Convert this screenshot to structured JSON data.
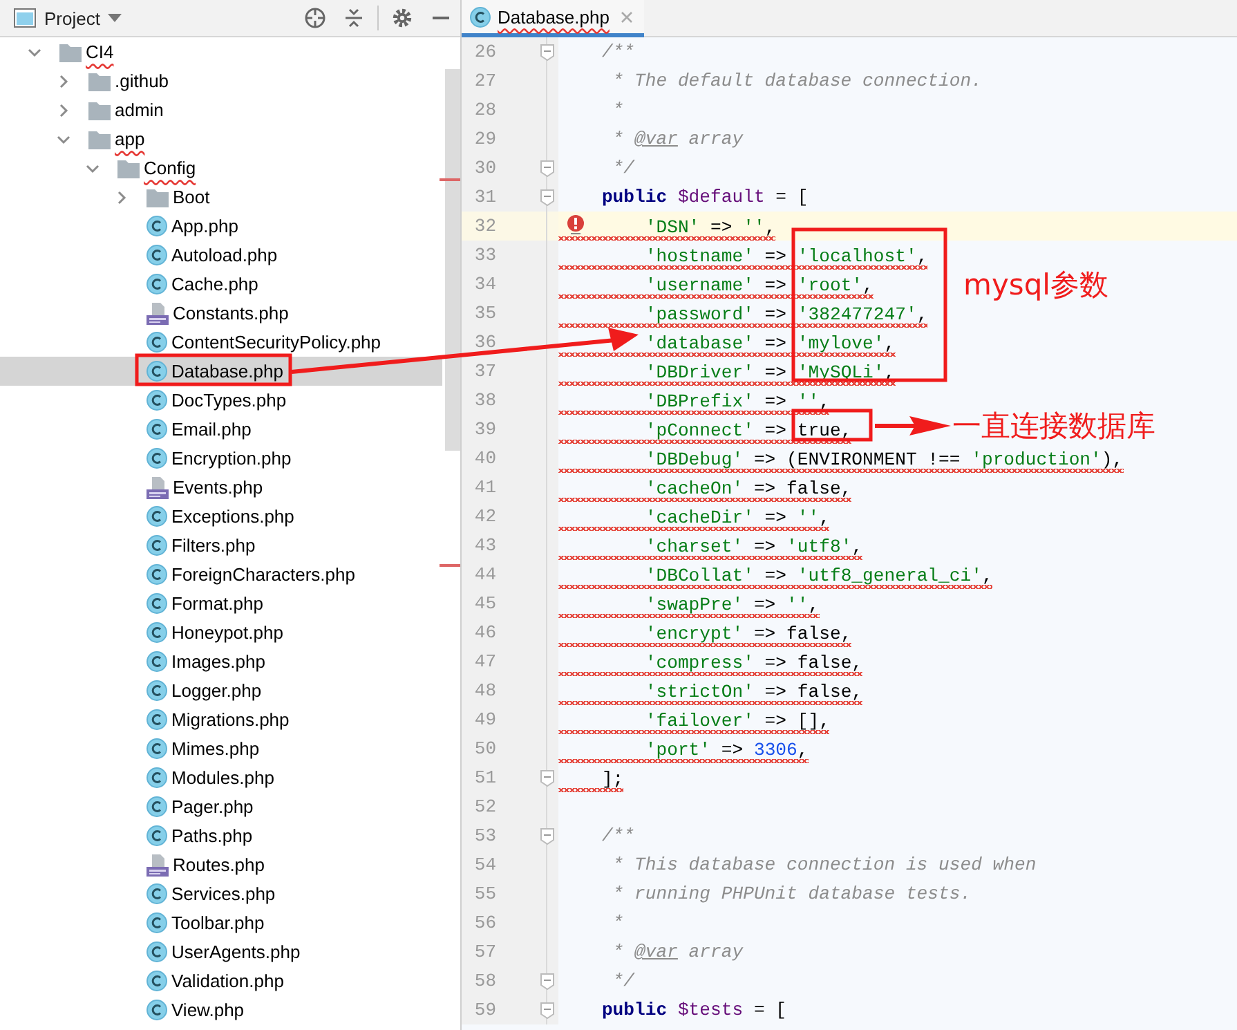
{
  "project_panel": {
    "title": "Project"
  },
  "tree": [
    {
      "name": "CI4",
      "kind": "folder",
      "expanded": true,
      "selected": false,
      "squiggle": true,
      "children": [
        {
          "name": ".github",
          "kind": "folder",
          "expanded": false,
          "selected": false,
          "squiggle": false
        },
        {
          "name": "admin",
          "kind": "folder",
          "expanded": false,
          "selected": false,
          "squiggle": false
        },
        {
          "name": "app",
          "kind": "folder",
          "expanded": true,
          "selected": false,
          "squiggle": true,
          "children": [
            {
              "name": "Config",
              "kind": "folder",
              "expanded": true,
              "selected": false,
              "squiggle": true,
              "children": [
                {
                  "name": "Boot",
                  "kind": "folder",
                  "expanded": false,
                  "selected": false,
                  "squiggle": false
                },
                {
                  "name": "App.php",
                  "kind": "class",
                  "selected": false,
                  "squiggle": false
                },
                {
                  "name": "Autoload.php",
                  "kind": "class",
                  "selected": false,
                  "squiggle": false
                },
                {
                  "name": "Cache.php",
                  "kind": "class",
                  "selected": false,
                  "squiggle": false
                },
                {
                  "name": "Constants.php",
                  "kind": "php",
                  "selected": false,
                  "squiggle": false
                },
                {
                  "name": "ContentSecurityPolicy.php",
                  "kind": "class",
                  "selected": false,
                  "squiggle": false
                },
                {
                  "name": "Database.php",
                  "kind": "class",
                  "selected": true,
                  "squiggle": false
                },
                {
                  "name": "DocTypes.php",
                  "kind": "class",
                  "selected": false,
                  "squiggle": false
                },
                {
                  "name": "Email.php",
                  "kind": "class",
                  "selected": false,
                  "squiggle": false
                },
                {
                  "name": "Encryption.php",
                  "kind": "class",
                  "selected": false,
                  "squiggle": false
                },
                {
                  "name": "Events.php",
                  "kind": "php",
                  "selected": false,
                  "squiggle": false
                },
                {
                  "name": "Exceptions.php",
                  "kind": "class",
                  "selected": false,
                  "squiggle": false
                },
                {
                  "name": "Filters.php",
                  "kind": "class",
                  "selected": false,
                  "squiggle": false
                },
                {
                  "name": "ForeignCharacters.php",
                  "kind": "class",
                  "selected": false,
                  "squiggle": false
                },
                {
                  "name": "Format.php",
                  "kind": "class",
                  "selected": false,
                  "squiggle": false
                },
                {
                  "name": "Honeypot.php",
                  "kind": "class",
                  "selected": false,
                  "squiggle": false
                },
                {
                  "name": "Images.php",
                  "kind": "class",
                  "selected": false,
                  "squiggle": false
                },
                {
                  "name": "Logger.php",
                  "kind": "class",
                  "selected": false,
                  "squiggle": false
                },
                {
                  "name": "Migrations.php",
                  "kind": "class",
                  "selected": false,
                  "squiggle": false
                },
                {
                  "name": "Mimes.php",
                  "kind": "class",
                  "selected": false,
                  "squiggle": false
                },
                {
                  "name": "Modules.php",
                  "kind": "class",
                  "selected": false,
                  "squiggle": false
                },
                {
                  "name": "Pager.php",
                  "kind": "class",
                  "selected": false,
                  "squiggle": false
                },
                {
                  "name": "Paths.php",
                  "kind": "class",
                  "selected": false,
                  "squiggle": false
                },
                {
                  "name": "Routes.php",
                  "kind": "php",
                  "selected": false,
                  "squiggle": false
                },
                {
                  "name": "Services.php",
                  "kind": "class",
                  "selected": false,
                  "squiggle": false
                },
                {
                  "name": "Toolbar.php",
                  "kind": "class",
                  "selected": false,
                  "squiggle": false
                },
                {
                  "name": "UserAgents.php",
                  "kind": "class",
                  "selected": false,
                  "squiggle": false
                },
                {
                  "name": "Validation.php",
                  "kind": "class",
                  "selected": false,
                  "squiggle": false
                },
                {
                  "name": "View.php",
                  "kind": "class",
                  "selected": false,
                  "squiggle": false
                }
              ]
            }
          ]
        }
      ]
    }
  ],
  "editor_tabs": [
    {
      "title": "Database.php",
      "selected": true,
      "squiggle": true
    }
  ],
  "lines": [
    {
      "number": "26",
      "fold": true,
      "highlighted": false,
      "error": false,
      "squiggle": false,
      "tokens": [
        {
          "kind": "comment",
          "text": "    /**"
        }
      ]
    },
    {
      "number": "27",
      "fold": false,
      "highlighted": false,
      "error": false,
      "squiggle": false,
      "tokens": [
        {
          "kind": "comment",
          "text": "     * The default database connection."
        }
      ]
    },
    {
      "number": "28",
      "fold": false,
      "highlighted": false,
      "error": false,
      "squiggle": false,
      "tokens": [
        {
          "kind": "comment",
          "text": "     *"
        }
      ]
    },
    {
      "number": "29",
      "fold": false,
      "highlighted": false,
      "error": false,
      "squiggle": false,
      "tokens": [
        {
          "kind": "comment",
          "text": "     * "
        },
        {
          "kind": "doctag",
          "text": "@var"
        },
        {
          "kind": "comment",
          "text": " array"
        }
      ]
    },
    {
      "number": "30",
      "fold": true,
      "highlighted": false,
      "error": false,
      "squiggle": false,
      "tokens": [
        {
          "kind": "comment",
          "text": "     */"
        }
      ]
    },
    {
      "number": "31",
      "fold": true,
      "highlighted": false,
      "error": false,
      "squiggle": false,
      "tokens": [
        {
          "kind": "keyword",
          "text": "    public "
        },
        {
          "kind": "variable",
          "text": "$default"
        },
        {
          "kind": "plain",
          "text": " = ["
        }
      ]
    },
    {
      "number": "32",
      "fold": false,
      "highlighted": true,
      "error": true,
      "squiggle": true,
      "tokens": [
        {
          "kind": "string",
          "text": "        'DSN'"
        },
        {
          "kind": "plain",
          "text": " => "
        },
        {
          "kind": "string",
          "text": "''"
        },
        {
          "kind": "plain",
          "text": ","
        }
      ]
    },
    {
      "number": "33",
      "fold": false,
      "highlighted": false,
      "error": false,
      "squiggle": true,
      "tokens": [
        {
          "kind": "string",
          "text": "        'hostname'"
        },
        {
          "kind": "plain",
          "text": " => "
        },
        {
          "kind": "string",
          "text": "'localhost'"
        },
        {
          "kind": "plain",
          "text": ","
        }
      ]
    },
    {
      "number": "34",
      "fold": false,
      "highlighted": false,
      "error": false,
      "squiggle": true,
      "tokens": [
        {
          "kind": "string",
          "text": "        'username'"
        },
        {
          "kind": "plain",
          "text": " => "
        },
        {
          "kind": "string",
          "text": "'root'"
        },
        {
          "kind": "plain",
          "text": ","
        }
      ]
    },
    {
      "number": "35",
      "fold": false,
      "highlighted": false,
      "error": false,
      "squiggle": true,
      "tokens": [
        {
          "kind": "string",
          "text": "        'password'"
        },
        {
          "kind": "plain",
          "text": " => "
        },
        {
          "kind": "string",
          "text": "'382477247'"
        },
        {
          "kind": "plain",
          "text": ","
        }
      ]
    },
    {
      "number": "36",
      "fold": false,
      "highlighted": false,
      "error": false,
      "squiggle": true,
      "tokens": [
        {
          "kind": "string",
          "text": "        'database'"
        },
        {
          "kind": "plain",
          "text": " => "
        },
        {
          "kind": "string",
          "text": "'mylove'"
        },
        {
          "kind": "plain",
          "text": ","
        }
      ]
    },
    {
      "number": "37",
      "fold": false,
      "highlighted": false,
      "error": false,
      "squiggle": true,
      "tokens": [
        {
          "kind": "string",
          "text": "        'DBDriver'"
        },
        {
          "kind": "plain",
          "text": " => "
        },
        {
          "kind": "string",
          "text": "'MySQLi'"
        },
        {
          "kind": "plain",
          "text": ","
        }
      ]
    },
    {
      "number": "38",
      "fold": false,
      "highlighted": false,
      "error": false,
      "squiggle": true,
      "tokens": [
        {
          "kind": "string",
          "text": "        'DBPrefix'"
        },
        {
          "kind": "plain",
          "text": " => "
        },
        {
          "kind": "string",
          "text": "''"
        },
        {
          "kind": "plain",
          "text": ","
        }
      ]
    },
    {
      "number": "39",
      "fold": false,
      "highlighted": false,
      "error": false,
      "squiggle": true,
      "tokens": [
        {
          "kind": "string",
          "text": "        'pConnect'"
        },
        {
          "kind": "plain",
          "text": " => true,"
        }
      ]
    },
    {
      "number": "40",
      "fold": false,
      "highlighted": false,
      "error": false,
      "squiggle": true,
      "tokens": [
        {
          "kind": "string",
          "text": "        'DBDebug'"
        },
        {
          "kind": "plain",
          "text": " => (ENVIRONMENT !== "
        },
        {
          "kind": "string",
          "text": "'production'"
        },
        {
          "kind": "plain",
          "text": "),"
        }
      ]
    },
    {
      "number": "41",
      "fold": false,
      "highlighted": false,
      "error": false,
      "squiggle": true,
      "tokens": [
        {
          "kind": "string",
          "text": "        'cacheOn'"
        },
        {
          "kind": "plain",
          "text": " => false,"
        }
      ]
    },
    {
      "number": "42",
      "fold": false,
      "highlighted": false,
      "error": false,
      "squiggle": true,
      "tokens": [
        {
          "kind": "string",
          "text": "        'cacheDir'"
        },
        {
          "kind": "plain",
          "text": " => "
        },
        {
          "kind": "string",
          "text": "''"
        },
        {
          "kind": "plain",
          "text": ","
        }
      ]
    },
    {
      "number": "43",
      "fold": false,
      "highlighted": false,
      "error": false,
      "squiggle": true,
      "tokens": [
        {
          "kind": "string",
          "text": "        'charset'"
        },
        {
          "kind": "plain",
          "text": " => "
        },
        {
          "kind": "string",
          "text": "'utf8'"
        },
        {
          "kind": "plain",
          "text": ","
        }
      ]
    },
    {
      "number": "44",
      "fold": false,
      "highlighted": false,
      "error": false,
      "squiggle": true,
      "tokens": [
        {
          "kind": "string",
          "text": "        'DBCollat'"
        },
        {
          "kind": "plain",
          "text": " => "
        },
        {
          "kind": "string",
          "text": "'utf8_general_ci'"
        },
        {
          "kind": "plain",
          "text": ","
        }
      ]
    },
    {
      "number": "45",
      "fold": false,
      "highlighted": false,
      "error": false,
      "squiggle": true,
      "tokens": [
        {
          "kind": "string",
          "text": "        'swapPre'"
        },
        {
          "kind": "plain",
          "text": " => "
        },
        {
          "kind": "string",
          "text": "''"
        },
        {
          "kind": "plain",
          "text": ","
        }
      ]
    },
    {
      "number": "46",
      "fold": false,
      "highlighted": false,
      "error": false,
      "squiggle": true,
      "tokens": [
        {
          "kind": "string",
          "text": "        'encrypt'"
        },
        {
          "kind": "plain",
          "text": " => false,"
        }
      ]
    },
    {
      "number": "47",
      "fold": false,
      "highlighted": false,
      "error": false,
      "squiggle": true,
      "tokens": [
        {
          "kind": "string",
          "text": "        'compress'"
        },
        {
          "kind": "plain",
          "text": " => false,"
        }
      ]
    },
    {
      "number": "48",
      "fold": false,
      "highlighted": false,
      "error": false,
      "squiggle": true,
      "tokens": [
        {
          "kind": "string",
          "text": "        'strictOn'"
        },
        {
          "kind": "plain",
          "text": " => false,"
        }
      ]
    },
    {
      "number": "49",
      "fold": false,
      "highlighted": false,
      "error": false,
      "squiggle": true,
      "tokens": [
        {
          "kind": "string",
          "text": "        'failover'"
        },
        {
          "kind": "plain",
          "text": " => [],"
        }
      ]
    },
    {
      "number": "50",
      "fold": false,
      "highlighted": false,
      "error": false,
      "squiggle": true,
      "tokens": [
        {
          "kind": "string",
          "text": "        'port'"
        },
        {
          "kind": "plain",
          "text": " => "
        },
        {
          "kind": "number",
          "text": "3306"
        },
        {
          "kind": "plain",
          "text": ","
        }
      ]
    },
    {
      "number": "51",
      "fold": true,
      "highlighted": false,
      "error": false,
      "squiggle": true,
      "tokens": [
        {
          "kind": "plain",
          "text": "    ];"
        }
      ]
    },
    {
      "number": "52",
      "fold": false,
      "highlighted": false,
      "error": false
    },
    {
      "number": "53",
      "fold": true,
      "highlighted": false,
      "error": false,
      "squiggle": false,
      "tokens": [
        {
          "kind": "comment",
          "text": "    /**"
        }
      ]
    },
    {
      "number": "54",
      "fold": false,
      "highlighted": false,
      "error": false,
      "squiggle": false,
      "tokens": [
        {
          "kind": "comment",
          "text": "     * This database connection is used when"
        }
      ]
    },
    {
      "number": "55",
      "fold": false,
      "highlighted": false,
      "error": false,
      "squiggle": false,
      "tokens": [
        {
          "kind": "comment",
          "text": "     * running PHPUnit database tests."
        }
      ]
    },
    {
      "number": "56",
      "fold": false,
      "highlighted": false,
      "error": false,
      "squiggle": false,
      "tokens": [
        {
          "kind": "comment",
          "text": "     *"
        }
      ]
    },
    {
      "number": "57",
      "fold": false,
      "highlighted": false,
      "error": false,
      "squiggle": false,
      "tokens": [
        {
          "kind": "comment",
          "text": "     * "
        },
        {
          "kind": "doctag",
          "text": "@var"
        },
        {
          "kind": "comment",
          "text": " array"
        }
      ]
    },
    {
      "number": "58",
      "fold": true,
      "highlighted": false,
      "error": false,
      "squiggle": false,
      "tokens": [
        {
          "kind": "comment",
          "text": "     */"
        }
      ]
    },
    {
      "number": "59",
      "fold": true,
      "highlighted": false,
      "error": false,
      "squiggle": false,
      "tokens": [
        {
          "kind": "keyword",
          "text": "    public "
        },
        {
          "kind": "variable",
          "text": "$tests"
        },
        {
          "kind": "plain",
          "text": " = ["
        }
      ]
    }
  ],
  "annotations": [
    {
      "text": "mysql参数"
    },
    {
      "text": "一直连接数据库"
    }
  ]
}
